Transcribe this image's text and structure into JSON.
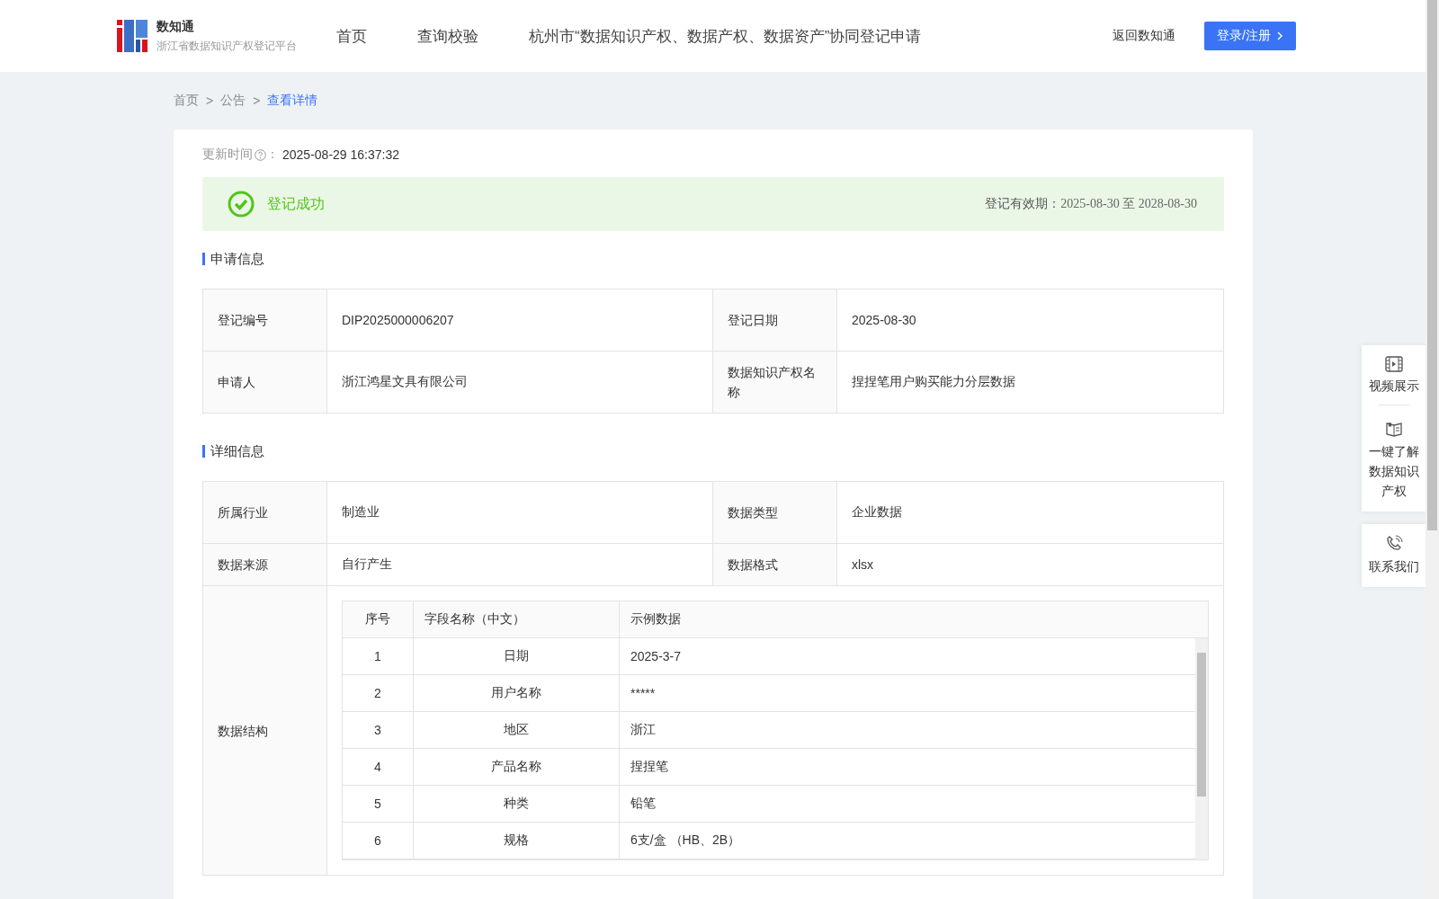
{
  "header": {
    "logo": {
      "title": "数知通",
      "subtitle": "浙江省数据知识产权登记平台"
    },
    "nav": [
      "首页",
      "查询校验",
      "杭州市“数据知识产权、数据产权、数据资产”协同登记申请"
    ],
    "back_link": "返回数知通",
    "login_button": "登录/注册"
  },
  "breadcrumb": [
    {
      "label": "首页",
      "current": false
    },
    {
      "label": "公告",
      "current": false,
      "separator": ">"
    },
    {
      "label": "查看详情",
      "current": true,
      "separator": ">"
    }
  ],
  "update": {
    "label": "更新时间",
    "colon": "：",
    "value": "2025-08-29 16:37:32"
  },
  "status": {
    "kind": "success",
    "text": "登记成功",
    "validity_label": "登记有效期：",
    "validity_range": "2025-08-30 至 2028-08-30"
  },
  "sections": [
    {
      "title": "申请信息",
      "rows": [
        {
          "kind": "pair",
          "cells": [
            {
              "label": "登记编号",
              "value": "DIP2025000006207"
            },
            {
              "label": "登记日期",
              "value": "2025-08-30"
            }
          ]
        },
        {
          "kind": "pair",
          "cells": [
            {
              "label": "申请人",
              "value": "浙江鸿星文具有限公司"
            },
            {
              "label": "数据知识产权名称",
              "value": "捏捏笔用户购买能力分层数据"
            }
          ]
        }
      ]
    },
    {
      "title": "详细信息",
      "rows": [
        {
          "kind": "pair",
          "cells": [
            {
              "label": "所属行业",
              "value": "制造业"
            },
            {
              "label": "数据类型",
              "value": "企业数据"
            }
          ]
        },
        {
          "kind": "pair",
          "cells": [
            {
              "label": "数据来源",
              "value": "自行产生"
            },
            {
              "label": "数据格式",
              "value": "xlsx"
            }
          ]
        },
        {
          "kind": "table",
          "label": "数据结构",
          "table": {
            "columns": [
              "序号",
              "字段名称（中文）",
              "示例数据"
            ],
            "rows": [
              [
                "1",
                "日期",
                "2025-3-7"
              ],
              [
                "2",
                "用户名称",
                "*****"
              ],
              [
                "3",
                "地区",
                "浙江"
              ],
              [
                "4",
                "产品名称",
                "捏捏笔"
              ],
              [
                "5",
                "种类",
                "铅笔"
              ],
              [
                "6",
                "规格",
                "6支/盒 （HB、2B）"
              ]
            ]
          }
        }
      ]
    }
  ],
  "side_panel": [
    [
      {
        "kind": "video",
        "label": "视频展示"
      },
      {
        "kind": "book",
        "label": "一键了解数据知识产权"
      }
    ],
    [
      {
        "kind": "phone",
        "label": "联系我们"
      }
    ]
  ]
}
